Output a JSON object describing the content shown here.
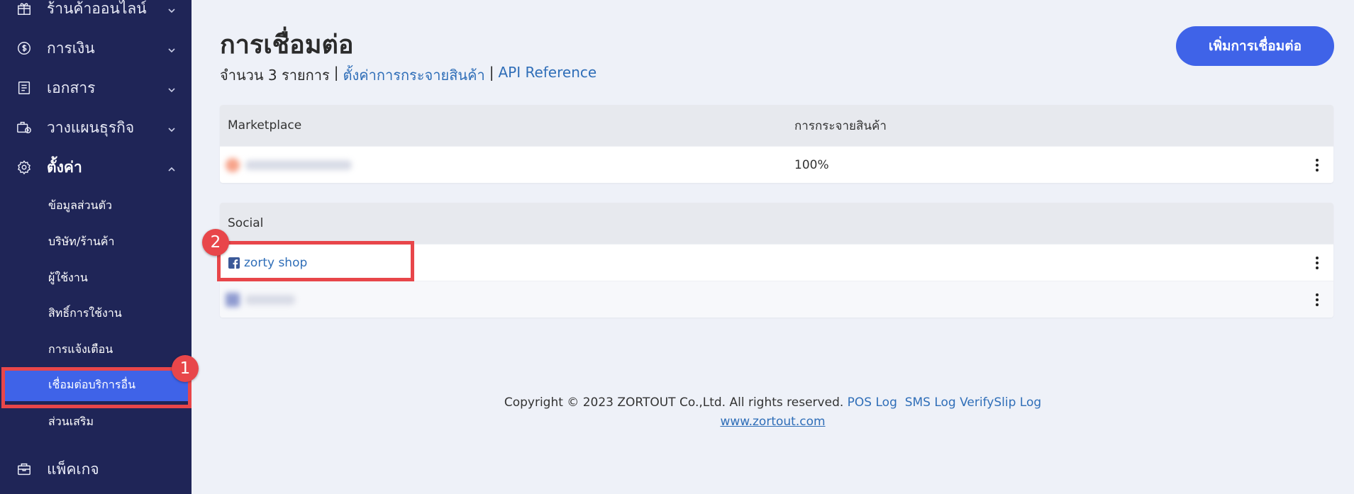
{
  "sidebar": {
    "items": [
      {
        "label": "ร้านค้าออนไลน์",
        "icon": "gift-icon"
      },
      {
        "label": "การเงิน",
        "icon": "dollar-icon"
      },
      {
        "label": "เอกสาร",
        "icon": "document-icon"
      },
      {
        "label": "วางแผนธุรกิจ",
        "icon": "business-plan-icon"
      },
      {
        "label": "ตั้งค่า",
        "icon": "gear-icon"
      },
      {
        "label": "แพ็คเกจ",
        "icon": "briefcase-icon"
      }
    ],
    "settings_sub": [
      "ข้อมูลส่วนตัว",
      "บริษัท/ร้านค้า",
      "ผู้ใช้งาน",
      "สิทธิ์การใช้งาน",
      "การแจ้งเตือน",
      "เชื่อมต่อบริการอื่น",
      "ส่วนเสริม"
    ]
  },
  "main": {
    "title": "การเชื่อมต่อ",
    "count_text": "จำนวน 3 รายการ",
    "separator": "|",
    "link_distribution": "ตั้งค่าการกระจายสินค้า",
    "link_api": "API Reference",
    "add_button": "เพิ่มการเชื่อมต่อ"
  },
  "marketplace_table": {
    "col1": "Marketplace",
    "col2": "การกระจายสินค้า",
    "rows": [
      {
        "distribution": "100%"
      }
    ]
  },
  "social_table": {
    "col1": "Social",
    "rows": [
      {
        "name": "zorty shop"
      }
    ]
  },
  "annotations": {
    "badge1": "1",
    "badge2": "2"
  },
  "footer": {
    "copyright": "Copyright © 2023 ZORTOUT Co.,Ltd. All rights reserved.",
    "pos_log": "POS Log",
    "sms_log": "SMS Log",
    "verifyslip_log": "VerifySlip Log",
    "website": "www.zortout.com"
  },
  "colors": {
    "sidebar_bg": "#1f2557",
    "accent": "#3f63e8",
    "annotation": "#e8464a",
    "link": "#2f6eb8"
  }
}
